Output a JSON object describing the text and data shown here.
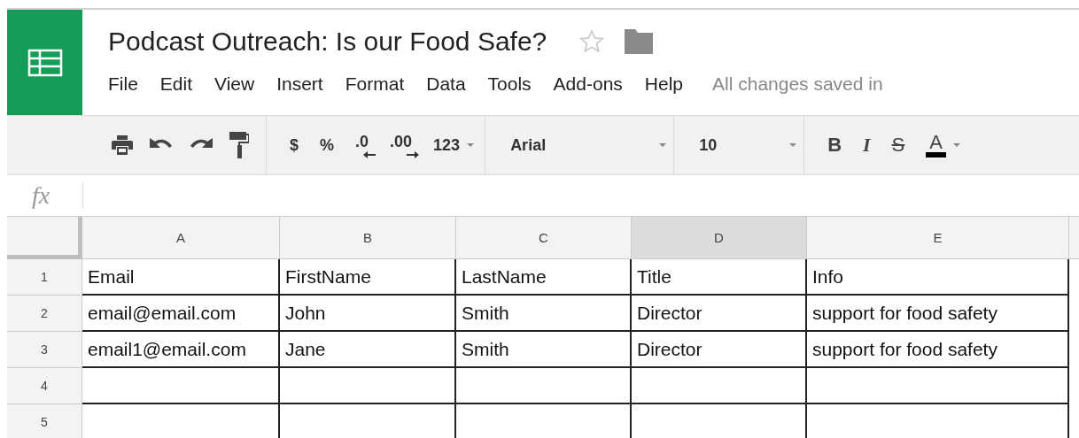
{
  "app": {
    "title": "Podcast Outreach: Is our Food Safe?",
    "starred": false,
    "menu": [
      "File",
      "Edit",
      "View",
      "Insert",
      "Format",
      "Data",
      "Tools",
      "Add-ons",
      "Help"
    ],
    "save_status": "All changes saved in"
  },
  "toolbar": {
    "number_formats": [
      {
        "label": "$",
        "kind": "plain"
      },
      {
        "label": "%",
        "kind": "plain"
      },
      {
        "label": ".0",
        "kind": "decrease"
      },
      {
        "label": ".00",
        "kind": "increase"
      },
      {
        "label": "123",
        "kind": "menu"
      }
    ],
    "font": "Arial",
    "font_size": "10",
    "text_styles": [
      {
        "label": "B",
        "kind": "bold"
      },
      {
        "label": "I",
        "kind": "italic"
      },
      {
        "label": "S",
        "kind": "strike"
      },
      {
        "label": "A",
        "kind": "color"
      }
    ]
  },
  "formula_bar": {
    "label": "fx"
  },
  "sheet": {
    "columns": [
      {
        "label": "A",
        "selected": false
      },
      {
        "label": "B",
        "selected": false
      },
      {
        "label": "C",
        "selected": false
      },
      {
        "label": "D",
        "selected": true
      },
      {
        "label": "E",
        "selected": false
      }
    ],
    "rows": [
      {
        "number": "1",
        "cells": [
          "Email",
          "FirstName",
          "LastName",
          "Title",
          "Info"
        ]
      },
      {
        "number": "2",
        "cells": [
          "email@email.com",
          "John",
          "Smith",
          "Director",
          "support for food safety"
        ]
      },
      {
        "number": "3",
        "cells": [
          "email1@email.com",
          "Jane",
          "Smith",
          "Director",
          "support for food safety"
        ]
      },
      {
        "number": "4"
      },
      {
        "number": "5"
      }
    ]
  }
}
